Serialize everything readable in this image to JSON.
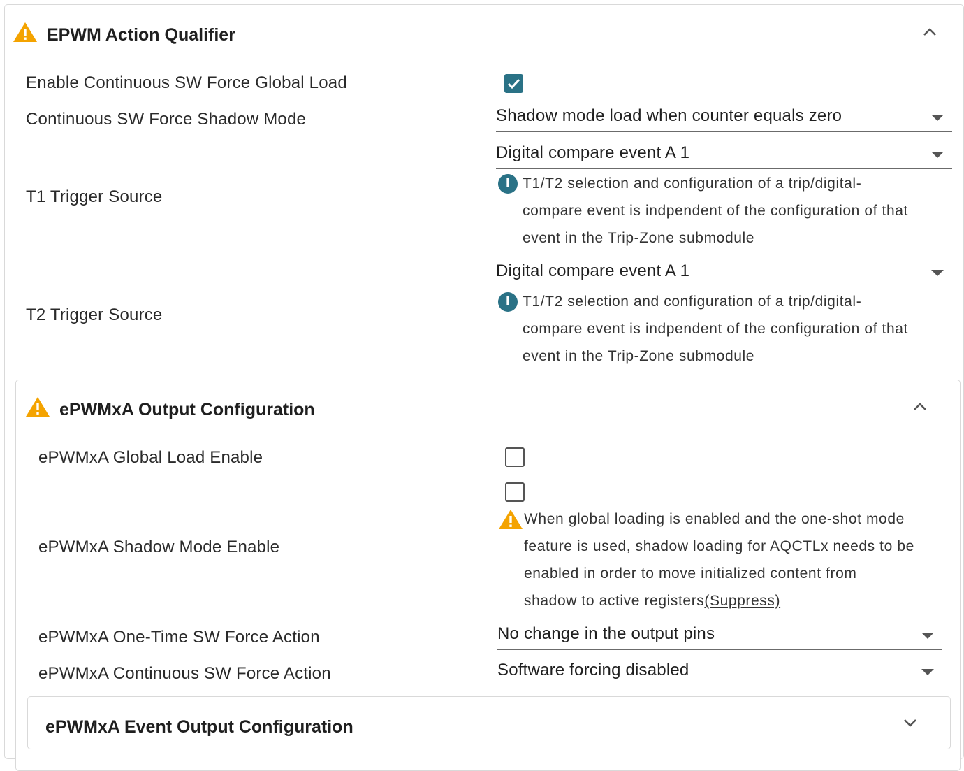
{
  "action_qualifier": {
    "title": "EPWM Action Qualifier",
    "rows": {
      "continuous_global_load": {
        "label": "Enable Continuous SW Force Global Load",
        "checked": true
      },
      "shadow_mode": {
        "label": "Continuous SW Force Shadow Mode",
        "value": "Shadow mode load when counter equals zero"
      },
      "t1_trigger": {
        "label": "T1 Trigger Source",
        "value": "Digital compare event A 1",
        "note": [
          "T1/T2 selection and configuration of a trip/digital-",
          "compare event is indpendent of the configuration of that",
          "event in the Trip-Zone submodule"
        ]
      },
      "t2_trigger": {
        "label": "T2 Trigger Source",
        "value": "Digital compare event A 1",
        "note": [
          "T1/T2 selection and configuration of a trip/digital-",
          "compare event is indpendent of the configuration of that",
          "event in the Trip-Zone submodule"
        ]
      }
    }
  },
  "output_a": {
    "title": "ePWMxA Output Configuration",
    "rows": {
      "global_load": {
        "label": "ePWMxA Global Load Enable",
        "checked": false
      },
      "shadow_mode_enable": {
        "label": "ePWMxA Shadow Mode Enable",
        "checked": false,
        "warning": [
          "When global loading is enabled and the one-shot mode",
          "feature is used, shadow loading for AQCTLx needs to be",
          "enabled in order to move initialized content from",
          "shadow to active registers"
        ],
        "suppress_label": "(Suppress)"
      },
      "one_time_force": {
        "label": "ePWMxA One-Time SW Force Action",
        "value": "No change in the output pins"
      },
      "continuous_force": {
        "label": "ePWMxA Continuous SW Force Action",
        "value": "Software forcing disabled"
      }
    },
    "event_output": {
      "title": "ePWMxA Event Output Configuration"
    }
  },
  "colors": {
    "accent": "#2a7286",
    "warning": "#f4a300"
  }
}
